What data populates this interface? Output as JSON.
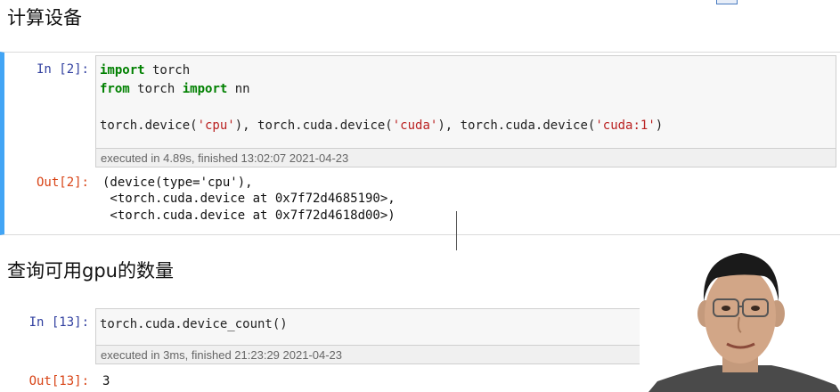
{
  "section1": {
    "title": "计算设备"
  },
  "cell1": {
    "in_prompt": "In [2]:",
    "code": {
      "l1_kw": "import",
      "l1_rest": " torch",
      "l2_kw1": "from",
      "l2_mid": " torch ",
      "l2_kw2": "import",
      "l2_rest": " nn",
      "l3_a": "torch.device(",
      "l3_s1": "'cpu'",
      "l3_b": "), torch.cuda.device(",
      "l3_s2": "'cuda'",
      "l3_c": "), torch.cuda.device(",
      "l3_s3": "'cuda:1'",
      "l3_d": ")"
    },
    "exec_info": "executed in 4.89s, finished 13:02:07 2021-04-23",
    "out_prompt": "Out[2]:",
    "output": [
      "(device(type='cpu'),",
      " <torch.cuda.device at 0x7f72d4685190>,",
      " <torch.cuda.device at 0x7f72d4618d00>)"
    ]
  },
  "section2": {
    "title": "查询可用gpu的数量"
  },
  "cell2": {
    "in_prompt": "In [13]:",
    "code": "torch.cuda.device_count()",
    "exec_info": "executed in 3ms, finished 21:23:29 2021-04-23",
    "out_prompt": "Out[13]:",
    "output": "3"
  },
  "icons": {
    "toolbar": "toolbar-icon",
    "presenter": "presenter-webcam-icon"
  },
  "colors": {
    "selected_border": "#42a5f5",
    "in_prompt": "#303f9f",
    "out_prompt": "#d84315",
    "keyword": "#008000",
    "string": "#ba2121"
  }
}
